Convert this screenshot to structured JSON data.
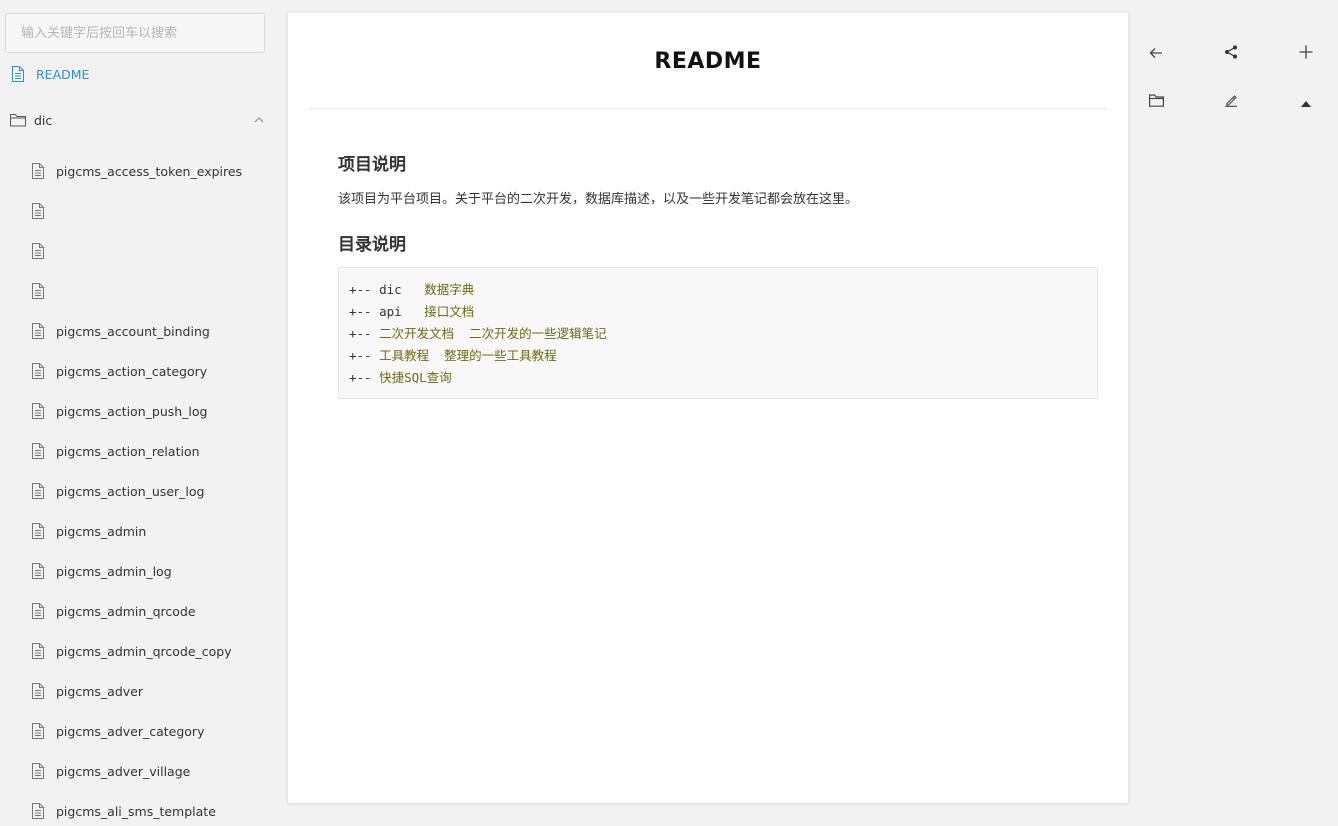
{
  "search": {
    "placeholder": "输入关键字后按回车以搜索"
  },
  "sidebar": {
    "readme_label": "README",
    "folder_label": "dic",
    "files": [
      "pigcms_access_token_expires",
      "",
      "",
      "",
      "pigcms_account_binding",
      "pigcms_action_category",
      "pigcms_action_push_log",
      "pigcms_action_relation",
      "pigcms_action_user_log",
      "pigcms_admin",
      "pigcms_admin_log",
      "pigcms_admin_qrcode",
      "pigcms_admin_qrcode_copy",
      "pigcms_adver",
      "pigcms_adver_category",
      "pigcms_adver_village",
      "pigcms_ali_sms_template"
    ]
  },
  "doc": {
    "title": "README",
    "section1_heading": "项目说明",
    "section1_text": "该项目为平台项目。关于平台的二次开发，数据库描述，以及一些开发笔记都会放在这里。",
    "section2_heading": "目录说明",
    "code_lines": [
      {
        "prefix": "+-- dic   ",
        "comment": "数据字典"
      },
      {
        "prefix": "+-- api   ",
        "comment": "接口文档"
      },
      {
        "prefix": "+-- ",
        "comment": "二次开发文档  二次开发的一些逻辑笔记"
      },
      {
        "prefix": "+-- ",
        "comment": "工具教程  整理的一些工具教程"
      },
      {
        "prefix": "+-- ",
        "comment": "快捷SQL查询"
      }
    ]
  },
  "toolbar": {
    "icons": [
      "back-arrow-icon",
      "share-icon",
      "plus-icon",
      "folder-icon",
      "edit-icon",
      "caret-up-icon"
    ]
  },
  "colors": {
    "accent": "#2f8fd5",
    "code_comment": "#6b6b14"
  }
}
